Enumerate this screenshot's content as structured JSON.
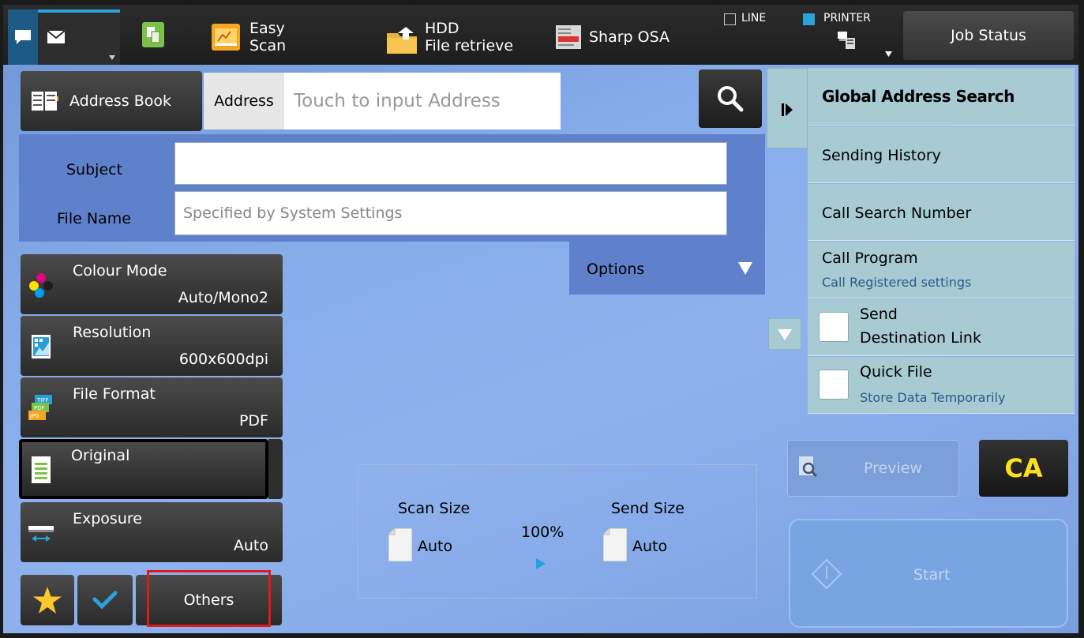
{
  "topbar": {
    "easy_scan": "Easy\nScan",
    "easy_scan_line1": "Easy",
    "easy_scan_line2": "Scan",
    "hdd_line1": "HDD",
    "hdd_line2": "File retrieve",
    "sharp_osa": "Sharp OSA",
    "line_label": "LINE",
    "printer_label": "PRINTER",
    "job_status": "Job Status"
  },
  "address": {
    "book_label": "Address Book",
    "address_label": "Address",
    "placeholder": "Touch to input Address"
  },
  "fields": {
    "subject_label": "Subject",
    "subject_value": "",
    "filename_label": "File Name",
    "filename_placeholder": "Specified by System Settings",
    "options_label": "Options"
  },
  "settings": [
    {
      "title": "Colour Mode",
      "value": "Auto/Mono2"
    },
    {
      "title": "Resolution",
      "value": "600x600dpi"
    },
    {
      "title": "File Format",
      "value": "PDF"
    },
    {
      "title": "Original",
      "value": ""
    },
    {
      "title": "Exposure",
      "value": "Auto"
    }
  ],
  "bottom": {
    "others_label": "Others"
  },
  "scan": {
    "scan_size_label": "Scan Size",
    "scan_size_value": "Auto",
    "ratio": "100%",
    "send_size_label": "Send Size",
    "send_size_value": "Auto"
  },
  "right_panel": {
    "global_search": "Global Address Search",
    "sending_history": "Sending History",
    "call_search_number": "Call Search Number",
    "call_program": "Call Program",
    "call_program_sub": "Call Registered settings",
    "send_link_line1": "Send",
    "send_link_line2": "Destination Link",
    "quick_file": "Quick File",
    "quick_file_sub": "Store Data Temporarily"
  },
  "actions": {
    "preview": "Preview",
    "ca": "CA",
    "start": "Start"
  },
  "icons": [
    "chat-icon",
    "mail-icon",
    "copy-icon",
    "easy-scan-icon",
    "hdd-folder-icon",
    "sharp-osa-icon",
    "printer-icon",
    "address-book-icon",
    "search-icon",
    "colour-mode-icon",
    "resolution-icon",
    "file-format-icon",
    "original-icon",
    "exposure-icon",
    "star-icon",
    "check-icon",
    "preview-icon",
    "start-icon"
  ],
  "colors": {
    "accent_blue": "#29a3d8",
    "ca_yellow": "#ffde1f",
    "panel_teal": "#a7cad3",
    "subject_blue": "#5f81cc",
    "highlight_red": "#e01919"
  }
}
